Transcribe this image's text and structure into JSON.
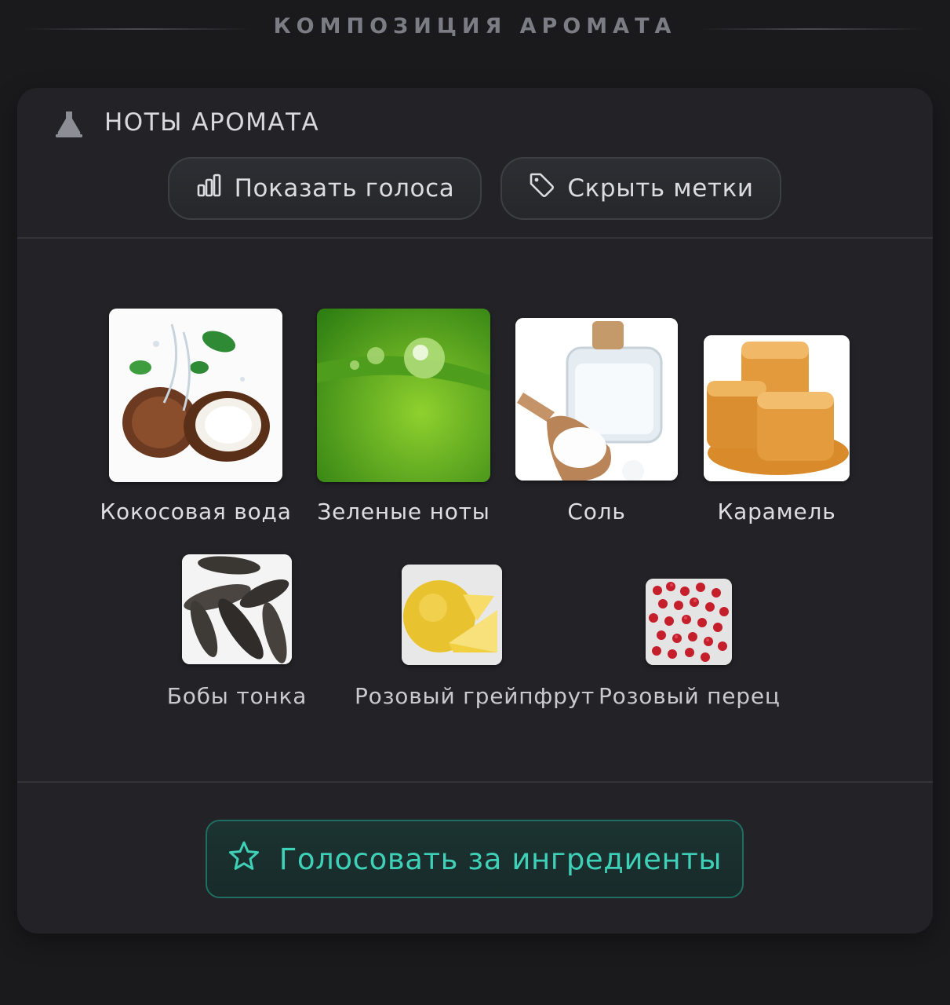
{
  "section": {
    "title": "КОМПОЗИЦИЯ АРОМАТА"
  },
  "card": {
    "title": "НОТЫ АРОМАТА",
    "icon": "flask-icon",
    "buttons": {
      "show_votes": {
        "label": "Показать голоса",
        "icon": "bar-chart-icon"
      },
      "hide_labels": {
        "label": "Скрыть метки",
        "icon": "tag-icon"
      }
    },
    "notes": [
      {
        "label": "Кокосовая вода",
        "image": "coconut-water-image"
      },
      {
        "label": "Зеленые ноты",
        "image": "green-notes-image"
      },
      {
        "label": "Соль",
        "image": "salt-image"
      },
      {
        "label": "Карамель",
        "image": "caramel-image"
      },
      {
        "label": "Бобы тонка",
        "image": "tonka-beans-image"
      },
      {
        "label": "Розовый грейпфрут",
        "image": "pink-grapefruit-image"
      },
      {
        "label": "Розовый перец",
        "image": "pink-pepper-image"
      }
    ],
    "vote_button": {
      "label": "Голосовать за ингредиенты",
      "icon": "star-icon"
    }
  },
  "colors": {
    "background": "#1a1a1d",
    "card": "#232327",
    "accent": "#3fd1b8"
  }
}
